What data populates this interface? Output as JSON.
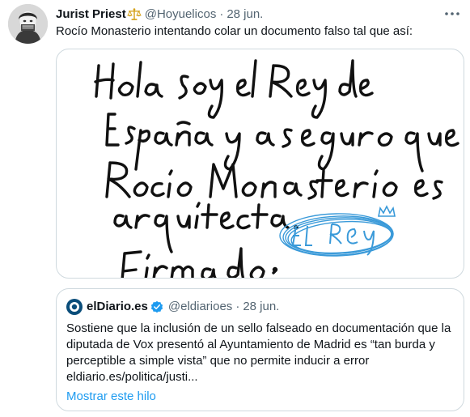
{
  "tweet": {
    "author_name": "Jurist Priest",
    "author_emoji": "⚖️",
    "handle": "@Hoyuelicos",
    "separator": "·",
    "date": "28 jun.",
    "text": "Rocío Monasterio intentando colar un documento falso tal que así:",
    "more_icon": "more-horizontal-icon"
  },
  "media": {
    "handwritten_text": "Hola soy el Rey de España y aseguro que Rocío Monasterio es arquitecta. Firmado: El Rey"
  },
  "quote": {
    "author_name": "elDiario.es",
    "verified_icon": "verified-badge-icon",
    "handle": "@eldiarioes",
    "separator": "·",
    "date": "28 jun.",
    "lines": [
      "Sostiene que la inclusión de un sello falseado en documentación que la",
      "diputada de Vox presentó al Ayuntamiento de Madrid es “tan burda y",
      "perceptible a simple vista” que no permite inducir a error",
      "eldiario.es/politica/justi..."
    ],
    "show_thread": "Mostrar este hilo"
  },
  "colors": {
    "text": "#0f1419",
    "secondary": "#536471",
    "link": "#1d9bf0",
    "border": "#cfd9de",
    "ink": "#111111",
    "stamp": "#3a9ad9"
  }
}
